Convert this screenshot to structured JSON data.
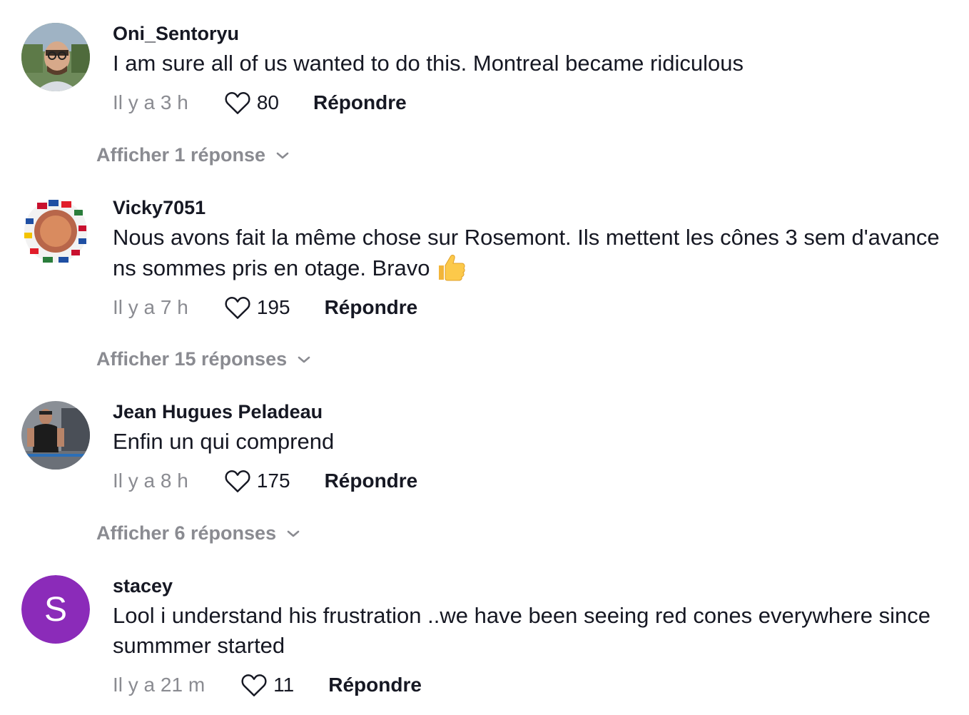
{
  "comments": [
    {
      "username": "Oni_Sentoryu",
      "text": "I am sure all of us wanted to do this. Montreal became ridiculous",
      "time": "Il y a 3 h",
      "likes": "80",
      "reply_label": "Répondre",
      "show_replies": "Afficher 1 réponse"
    },
    {
      "username": "Vicky7051",
      "text": "Nous avons fait la même chose sur Rosemont. Ils mettent les cônes 3 sem d'avance ns sommes pris en otage. Bravo",
      "time": "Il y a 7 h",
      "likes": "195",
      "reply_label": "Répondre",
      "show_replies": "Afficher 15 réponses"
    },
    {
      "username": "Jean Hugues Peladeau",
      "text": "Enfin un qui comprend",
      "time": "Il y a 8 h",
      "likes": "175",
      "reply_label": "Répondre",
      "show_replies": "Afficher 6 réponses"
    },
    {
      "username": "stacey",
      "avatar_initial": "S",
      "text": "Lool i understand his frustration ..we have been seeing red cones everywhere since summmer started",
      "time": "Il y a 21 m",
      "likes": "11",
      "reply_label": "Répondre"
    }
  ],
  "icons": {
    "like": "heart-outline-icon",
    "expand": "chevron-down-icon",
    "emoji": "thumbs-up-emoji"
  },
  "colors": {
    "text_primary": "#161823",
    "text_secondary": "#8a8b91",
    "avatar_purple": "#8b2bb9"
  }
}
